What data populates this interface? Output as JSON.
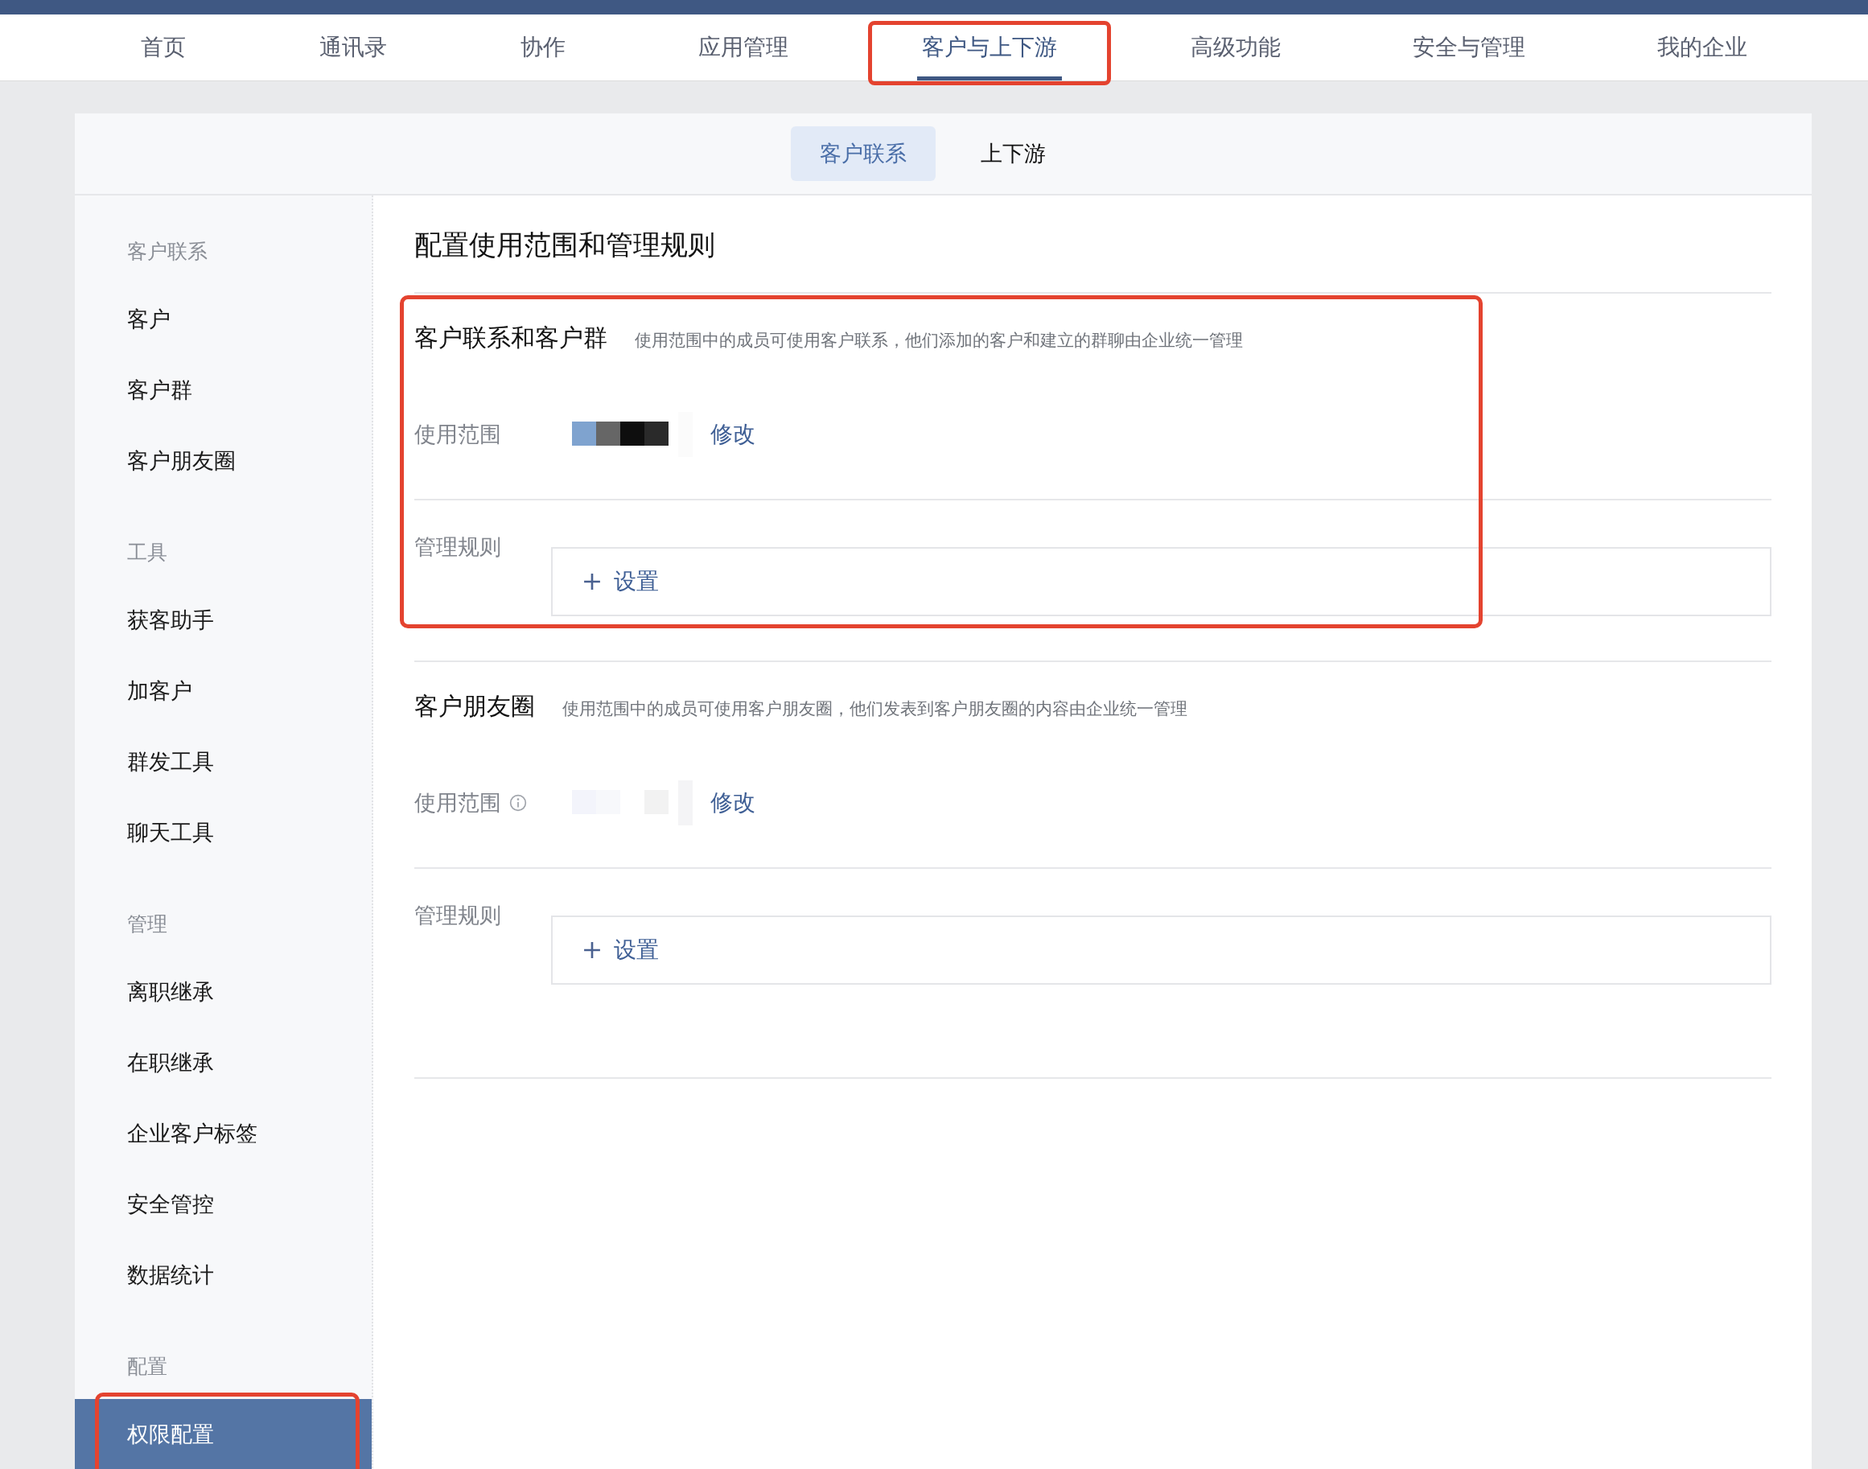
{
  "nav": {
    "tabs": [
      {
        "label": "首页",
        "selected": false,
        "highlighted": false
      },
      {
        "label": "通讯录",
        "selected": false,
        "highlighted": false
      },
      {
        "label": "协作",
        "selected": false,
        "highlighted": false
      },
      {
        "label": "应用管理",
        "selected": false,
        "highlighted": false
      },
      {
        "label": "客户与上下游",
        "selected": true,
        "highlighted": true
      },
      {
        "label": "高级功能",
        "selected": false,
        "highlighted": false
      },
      {
        "label": "安全与管理",
        "selected": false,
        "highlighted": false
      },
      {
        "label": "我的企业",
        "selected": false,
        "highlighted": false
      }
    ]
  },
  "subtabs": [
    {
      "label": "客户联系",
      "selected": true
    },
    {
      "label": "上下游",
      "selected": false
    }
  ],
  "sidebar": {
    "groups": [
      {
        "title": "客户联系",
        "items": [
          {
            "label": "客户",
            "selected": false,
            "highlighted": false
          },
          {
            "label": "客户群",
            "selected": false,
            "highlighted": false
          },
          {
            "label": "客户朋友圈",
            "selected": false,
            "highlighted": false
          }
        ]
      },
      {
        "title": "工具",
        "items": [
          {
            "label": "获客助手",
            "selected": false,
            "highlighted": false
          },
          {
            "label": "加客户",
            "selected": false,
            "highlighted": false
          },
          {
            "label": "群发工具",
            "selected": false,
            "highlighted": false
          },
          {
            "label": "聊天工具",
            "selected": false,
            "highlighted": false
          }
        ]
      },
      {
        "title": "管理",
        "items": [
          {
            "label": "离职继承",
            "selected": false,
            "highlighted": false
          },
          {
            "label": "在职继承",
            "selected": false,
            "highlighted": false
          },
          {
            "label": "企业客户标签",
            "selected": false,
            "highlighted": false
          },
          {
            "label": "安全管控",
            "selected": false,
            "highlighted": false
          },
          {
            "label": "数据统计",
            "selected": false,
            "highlighted": false
          }
        ]
      },
      {
        "title": "配置",
        "items": [
          {
            "label": "权限配置",
            "selected": true,
            "highlighted": true
          }
        ]
      }
    ]
  },
  "content": {
    "title": "配置使用范围和管理规则",
    "sections": [
      {
        "title": "客户联系和客户群",
        "description": "使用范围中的成员可使用客户联系，他们添加的客户和建立的群聊由企业统一管理",
        "highlighted": true,
        "scope": {
          "label": "使用范围",
          "info": false,
          "link": "修改"
        },
        "rules": {
          "label": "管理规则",
          "button": "设置"
        }
      },
      {
        "title": "客户朋友圈",
        "description": "使用范围中的成员可使用客户朋友圈，他们发表到客户朋友圈的内容由企业统一管理",
        "highlighted": false,
        "scope": {
          "label": "使用范围",
          "info": true,
          "link": "修改"
        },
        "rules": {
          "label": "管理规则",
          "button": "设置"
        }
      }
    ]
  }
}
